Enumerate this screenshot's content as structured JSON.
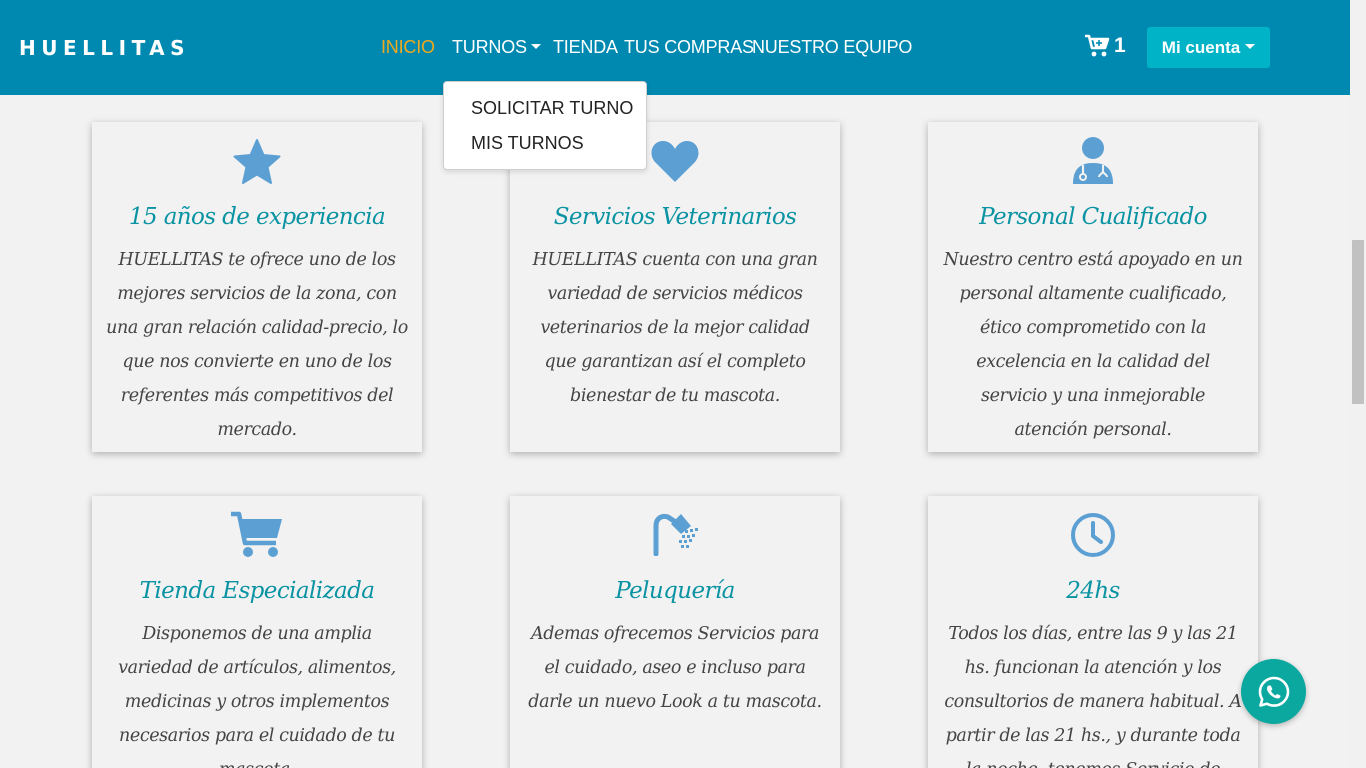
{
  "brand": "HUELLITAS",
  "nav": {
    "items": [
      {
        "label": "INICIO",
        "active": true
      },
      {
        "label": "TURNOS",
        "has_dropdown": true
      },
      {
        "label": "TIENDA"
      },
      {
        "label": "TUS COMPRAS"
      },
      {
        "label": "NUESTRO EQUIPO"
      }
    ],
    "cart_icon": "shopping-cart-icon",
    "cart_count": "1",
    "account_label": "Mi cuenta"
  },
  "dropdown": {
    "items": [
      "SOLICITAR TURNO",
      "MIS TURNOS"
    ]
  },
  "cards": [
    {
      "icon": "star-icon",
      "title": "15 años de experiencia",
      "text": "HUELLITAS te ofrece uno de los mejores servicios de la zona, con una gran relación calidad-precio, lo que nos convierte en uno de los referentes más competitivos del mercado."
    },
    {
      "icon": "heart-icon",
      "title": "Servicios Veterinarios",
      "text": "HUELLITAS cuenta con una gran variedad de servicios médicos veterinarios de la mejor calidad que garantizan así el completo bienestar de tu mascota."
    },
    {
      "icon": "doctor-icon",
      "title": "Personal Cualificado",
      "text": "Nuestro centro está apoyado en un personal altamente cualificado, ético comprometido con la excelencia en la calidad del servicio y una inmejorable atención personal."
    },
    {
      "icon": "cart-icon",
      "title": "Tienda Especializada",
      "text": "Disponemos de una amplia variedad de artículos, alimentos, medicinas y otros implementos necesarios para el cuidado de tu mascota."
    },
    {
      "icon": "shower-icon",
      "title": "Peluquería",
      "text": "Ademas ofrecemos Servicios para el cuidado, aseo e incluso para darle un nuevo Look a tu mascota."
    },
    {
      "icon": "clock-icon",
      "title": "24hs",
      "text": "Todos los días, entre las 9 y las 21 hs. funcionan la atención y los consultorios de manera habitual. A partir de las 21 hs., y durante toda la noche, tenemos Servicio de"
    }
  ],
  "colors": {
    "navbar": "#0089b0",
    "active_link": "#f0a91e",
    "account_button": "#00b3c7",
    "card_title": "#0a93a3",
    "icon": "#5b9fd3",
    "whatsapp": "#0aa89e"
  },
  "whatsapp_icon": "whatsapp-icon"
}
